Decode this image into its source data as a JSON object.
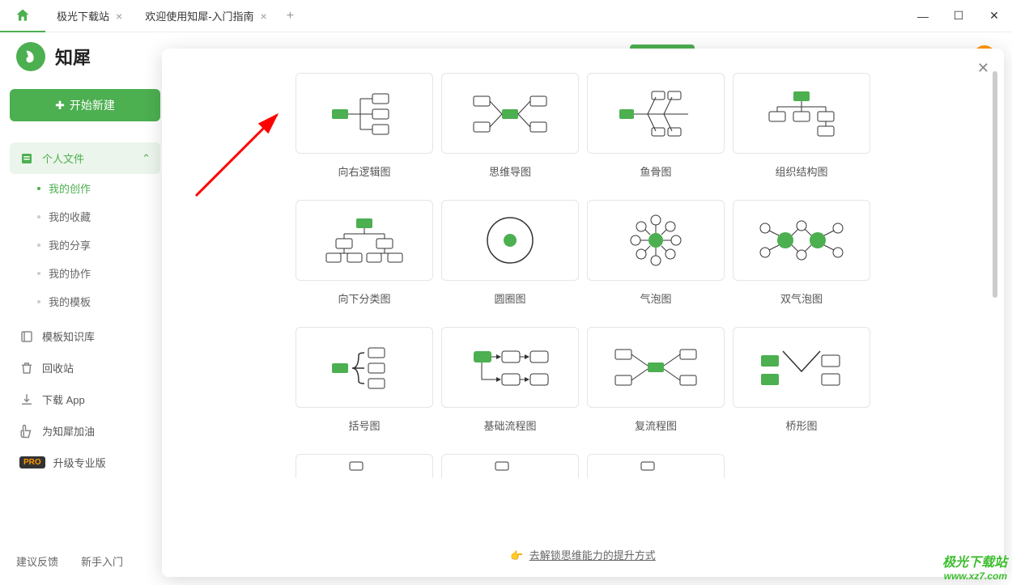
{
  "tabs": [
    {
      "label": "极光下载站"
    },
    {
      "label": "欢迎使用知犀-入门指南"
    }
  ],
  "app": {
    "name": "知犀"
  },
  "sidebar": {
    "start": "开始新建",
    "personal": "个人文件",
    "subs": [
      "我的创作",
      "我的收藏",
      "我的分享",
      "我的协作",
      "我的模板"
    ],
    "template_lib": "模板知识库",
    "recycle": "回收站",
    "download": "下载 App",
    "cheer": "为知犀加油",
    "upgrade": "升级专业版"
  },
  "footer": {
    "feedback": "建议反馈",
    "guide": "新手入门"
  },
  "modal": {
    "templates": [
      "向右逻辑图",
      "思维导图",
      "鱼骨图",
      "组织结构图",
      "向下分类图",
      "圆圈图",
      "气泡图",
      "双气泡图",
      "括号图",
      "基础流程图",
      "复流程图",
      "桥形图"
    ],
    "footer_link": "去解锁思维能力的提升方式"
  },
  "watermark": {
    "top": "极光下载站",
    "bot": "www.xz7.com"
  }
}
